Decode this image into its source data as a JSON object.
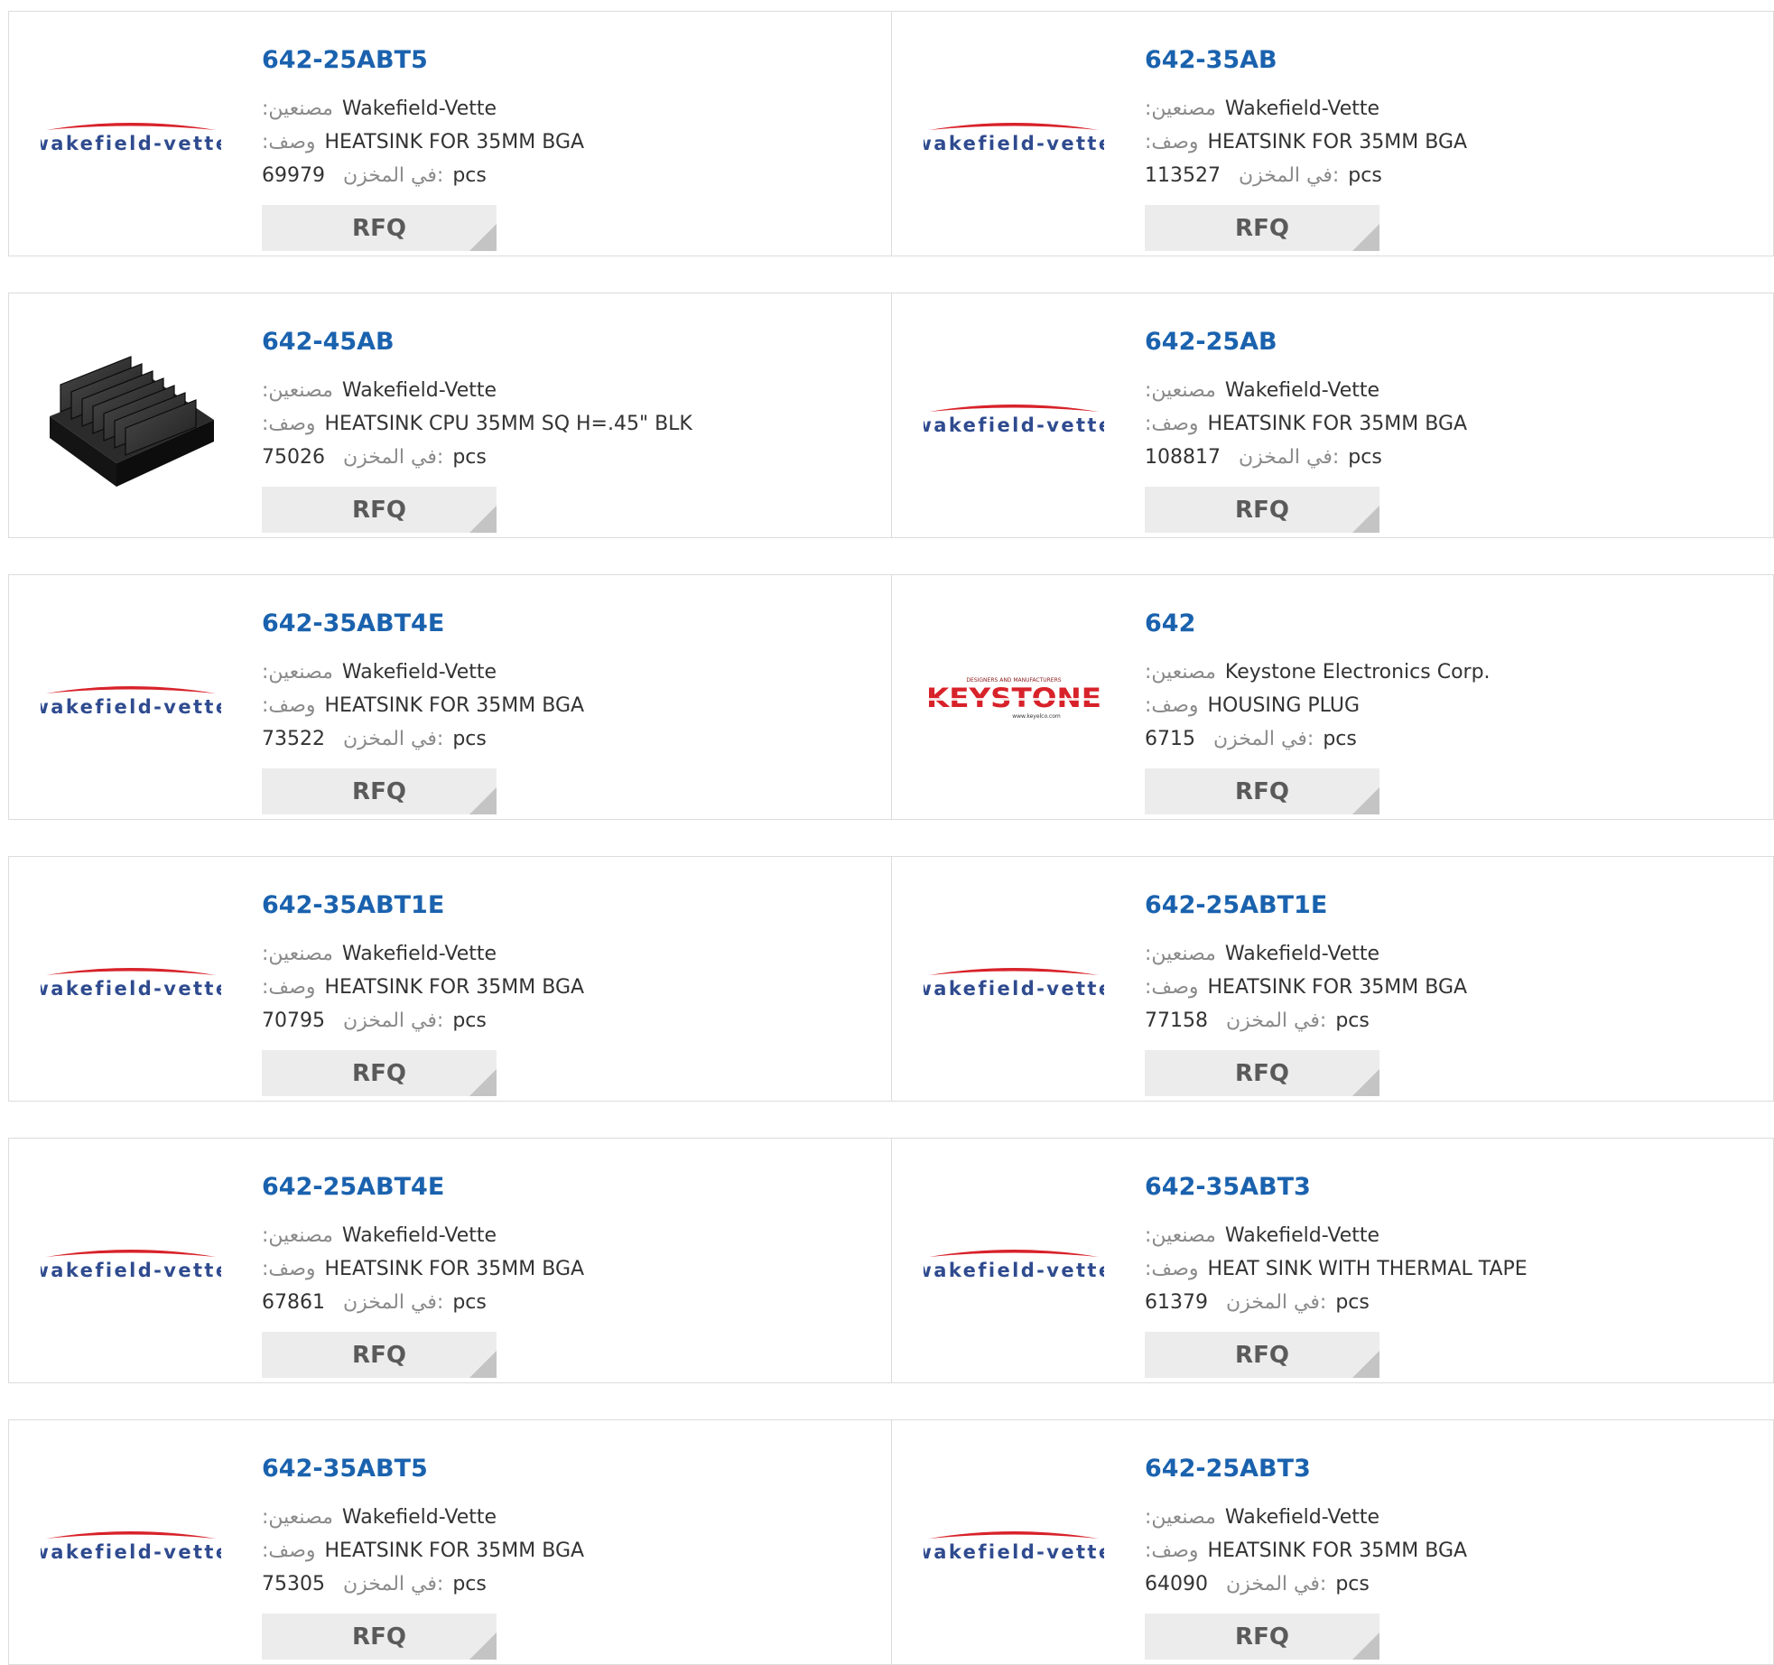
{
  "labels": {
    "manufacturer": ":مصنعين",
    "description": ":وصف",
    "in_stock": "في المخزن:",
    "unit": "pcs",
    "rfq": "RFQ"
  },
  "logos": {
    "wakefield_vette": "wakefield-vette",
    "keystone": "KEYSTONE",
    "keystone_tagline": "DESIGNERS AND MANUFACTURERS",
    "keystone_url": "www.keyelco.com"
  },
  "colors": {
    "part_number": "#1a62ae",
    "border": "#dcdcdc",
    "rfq_bg": "#ececec",
    "rfq_corner": "#c4c4c4",
    "wakefield_text": "#2f4b8f",
    "wakefield_swoosh": "#d8222a",
    "keystone_red": "#d8222a"
  },
  "products": [
    {
      "part_number": "642-25ABT5",
      "manufacturer": "Wakefield-Vette",
      "description": "HEATSINK FOR 35MM BGA",
      "stock": "69979",
      "image": "wakefield-vette-logo"
    },
    {
      "part_number": "642-35AB",
      "manufacturer": "Wakefield-Vette",
      "description": "HEATSINK FOR 35MM BGA",
      "stock": "113527",
      "image": "wakefield-vette-logo"
    },
    {
      "part_number": "642-45AB",
      "manufacturer": "Wakefield-Vette",
      "description": "HEATSINK CPU 35MM SQ H=.45\" BLK",
      "stock": "75026",
      "image": "heatsink-photo"
    },
    {
      "part_number": "642-25AB",
      "manufacturer": "Wakefield-Vette",
      "description": "HEATSINK FOR 35MM BGA",
      "stock": "108817",
      "image": "wakefield-vette-logo"
    },
    {
      "part_number": "642-35ABT4E",
      "manufacturer": "Wakefield-Vette",
      "description": "HEATSINK FOR 35MM BGA",
      "stock": "73522",
      "image": "wakefield-vette-logo"
    },
    {
      "part_number": "642",
      "manufacturer": "Keystone Electronics Corp.",
      "description": "HOUSING PLUG",
      "stock": "6715",
      "image": "keystone-logo"
    },
    {
      "part_number": "642-35ABT1E",
      "manufacturer": "Wakefield-Vette",
      "description": "HEATSINK FOR 35MM BGA",
      "stock": "70795",
      "image": "wakefield-vette-logo"
    },
    {
      "part_number": "642-25ABT1E",
      "manufacturer": "Wakefield-Vette",
      "description": "HEATSINK FOR 35MM BGA",
      "stock": "77158",
      "image": "wakefield-vette-logo"
    },
    {
      "part_number": "642-25ABT4E",
      "manufacturer": "Wakefield-Vette",
      "description": "HEATSINK FOR 35MM BGA",
      "stock": "67861",
      "image": "wakefield-vette-logo"
    },
    {
      "part_number": "642-35ABT3",
      "manufacturer": "Wakefield-Vette",
      "description": "HEAT SINK WITH THERMAL TAPE",
      "stock": "61379",
      "image": "wakefield-vette-logo"
    },
    {
      "part_number": "642-35ABT5",
      "manufacturer": "Wakefield-Vette",
      "description": "HEATSINK FOR 35MM BGA",
      "stock": "75305",
      "image": "wakefield-vette-logo"
    },
    {
      "part_number": "642-25ABT3",
      "manufacturer": "Wakefield-Vette",
      "description": "HEATSINK FOR 35MM BGA",
      "stock": "64090",
      "image": "wakefield-vette-logo"
    }
  ]
}
